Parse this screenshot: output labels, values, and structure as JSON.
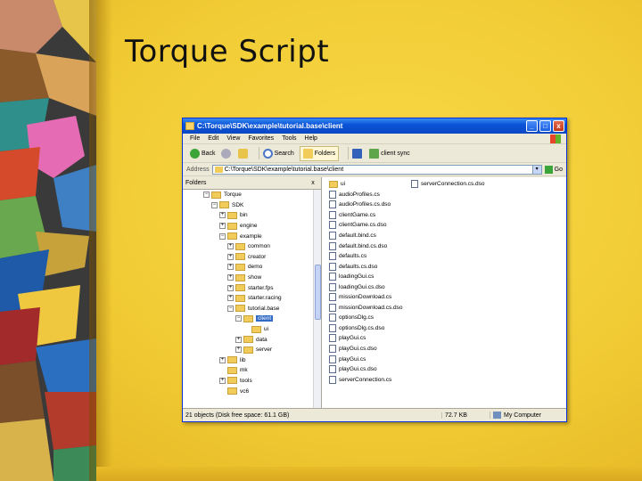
{
  "slide": {
    "title": "Torque Script",
    "accent": "#f2cf3a"
  },
  "window": {
    "title": "C:\\Torque\\SDK\\example\\tutorial.base\\client",
    "controls": {
      "minimize": "_",
      "maximize": "□",
      "close": "x"
    },
    "menu": [
      "File",
      "Edit",
      "View",
      "Favorites",
      "Tools",
      "Help"
    ],
    "toolbar": {
      "back": "Back",
      "search": "Search",
      "folders": "Folders",
      "client_sync": "client sync"
    },
    "address": {
      "label": "Address",
      "value": "C:\\Torque\\SDK\\example\\tutorial.base\\client",
      "dropdown": "▾",
      "go": "Go"
    },
    "folders_pane": {
      "title": "Folders",
      "close": "x",
      "tree": [
        {
          "label": "Torque",
          "depth": 3,
          "expander": "−"
        },
        {
          "label": "SDK",
          "depth": 4,
          "expander": "−"
        },
        {
          "label": "bin",
          "depth": 5,
          "expander": "+"
        },
        {
          "label": "engine",
          "depth": 5,
          "expander": "+"
        },
        {
          "label": "example",
          "depth": 5,
          "expander": "−"
        },
        {
          "label": "common",
          "depth": 6,
          "expander": "+"
        },
        {
          "label": "creator",
          "depth": 6,
          "expander": "+"
        },
        {
          "label": "demo",
          "depth": 6,
          "expander": "+"
        },
        {
          "label": "show",
          "depth": 6,
          "expander": "+"
        },
        {
          "label": "starter.fps",
          "depth": 6,
          "expander": "+"
        },
        {
          "label": "starter.racing",
          "depth": 6,
          "expander": "+"
        },
        {
          "label": "tutorial.base",
          "depth": 6,
          "expander": "−"
        },
        {
          "label": "client",
          "depth": 7,
          "expander": "−",
          "selected": true
        },
        {
          "label": "ui",
          "depth": 8,
          "expander": ""
        },
        {
          "label": "data",
          "depth": 7,
          "expander": "+"
        },
        {
          "label": "server",
          "depth": 7,
          "expander": "+"
        },
        {
          "label": "lib",
          "depth": 5,
          "expander": "+"
        },
        {
          "label": "mk",
          "depth": 5,
          "expander": ""
        },
        {
          "label": "tools",
          "depth": 5,
          "expander": "+"
        },
        {
          "label": "vc6",
          "depth": 5,
          "expander": ""
        }
      ]
    },
    "files": {
      "column1": [
        {
          "name": "ui",
          "type": "folder"
        },
        {
          "name": "audioProfiles.cs",
          "type": "file"
        },
        {
          "name": "audioProfiles.cs.dso",
          "type": "file"
        },
        {
          "name": "clientGame.cs",
          "type": "file"
        },
        {
          "name": "clientGame.cs.dso",
          "type": "file"
        },
        {
          "name": "default.bind.cs",
          "type": "file"
        },
        {
          "name": "default.bind.cs.dso",
          "type": "file"
        },
        {
          "name": "defaults.cs",
          "type": "file"
        },
        {
          "name": "defaults.cs.dso",
          "type": "file"
        },
        {
          "name": "loadingGui.cs",
          "type": "file"
        },
        {
          "name": "loadingGui.cs.dso",
          "type": "file"
        },
        {
          "name": "missionDownload.cs",
          "type": "file"
        },
        {
          "name": "missionDownload.cs.dso",
          "type": "file"
        },
        {
          "name": "optionsDlg.cs",
          "type": "file"
        },
        {
          "name": "optionsDlg.cs.dso",
          "type": "file"
        },
        {
          "name": "playGui.cs",
          "type": "file"
        },
        {
          "name": "playGui.cs.dso",
          "type": "file"
        },
        {
          "name": "playGui.cs",
          "type": "file"
        },
        {
          "name": "playGui.cs.dso",
          "type": "file"
        },
        {
          "name": "serverConnection.cs",
          "type": "file"
        }
      ],
      "column2": [
        {
          "name": "serverConnection.cs.dso",
          "type": "file"
        }
      ]
    },
    "status": {
      "left": "21 objects (Disk free space: 61.1 GB)",
      "size": "72.7 KB",
      "zone": "My Computer"
    }
  }
}
